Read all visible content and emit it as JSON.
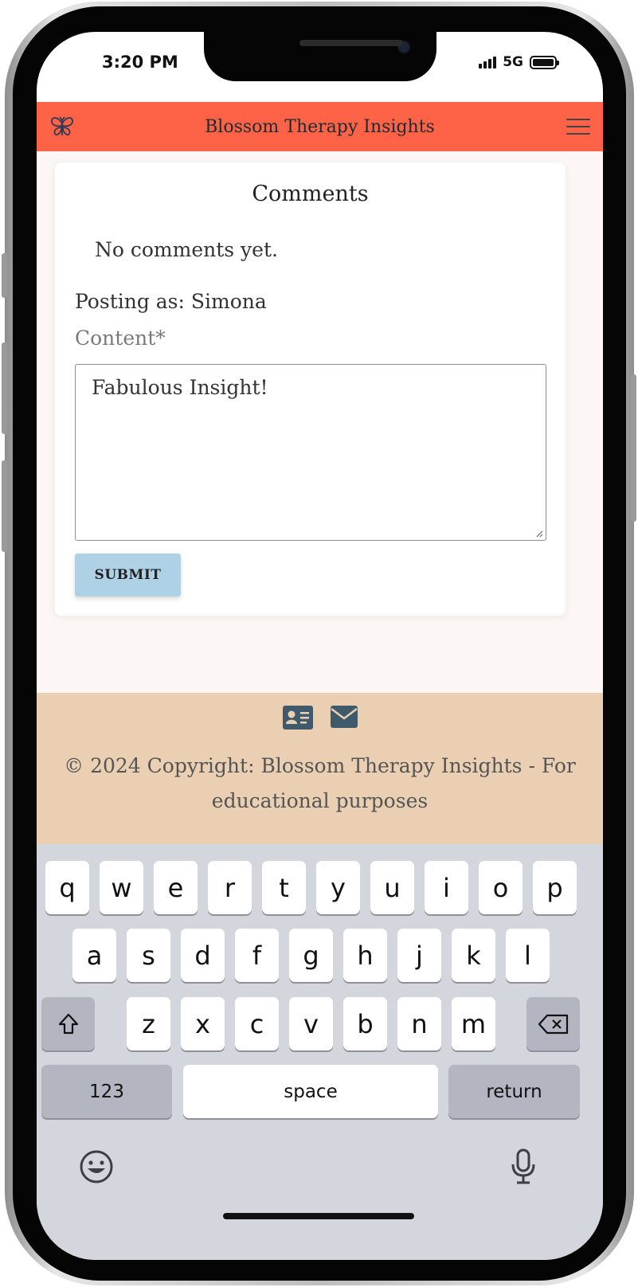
{
  "status_bar": {
    "time": "3:20 PM",
    "network": "5G"
  },
  "navbar": {
    "brand_icon": "butterfly-icon",
    "title": "Blossom Therapy Insights",
    "menu_icon": "hamburger-icon"
  },
  "comments": {
    "heading": "Comments",
    "empty_text": "No comments yet.",
    "posting_as": "Posting as: Simona",
    "content_label": "Content*",
    "content_value": "Fabulous Insight!",
    "submit_label": "SUBMIT"
  },
  "footer": {
    "icons": [
      "id-card-icon",
      "envelope-icon"
    ],
    "copyright": "© 2024 Copyright: Blossom Therapy Insights - For educational purposes"
  },
  "keyboard": {
    "row1": [
      "q",
      "w",
      "e",
      "r",
      "t",
      "y",
      "u",
      "i",
      "o",
      "p"
    ],
    "row2": [
      "a",
      "s",
      "d",
      "f",
      "g",
      "h",
      "j",
      "k",
      "l"
    ],
    "row3": [
      "z",
      "x",
      "c",
      "v",
      "b",
      "n",
      "m"
    ],
    "shift_icon": "shift-icon",
    "delete_icon": "backspace-icon",
    "numbers_label": "123",
    "space_label": "space",
    "return_label": "return",
    "emoji_icon": "emoji-icon",
    "mic_icon": "microphone-icon"
  }
}
